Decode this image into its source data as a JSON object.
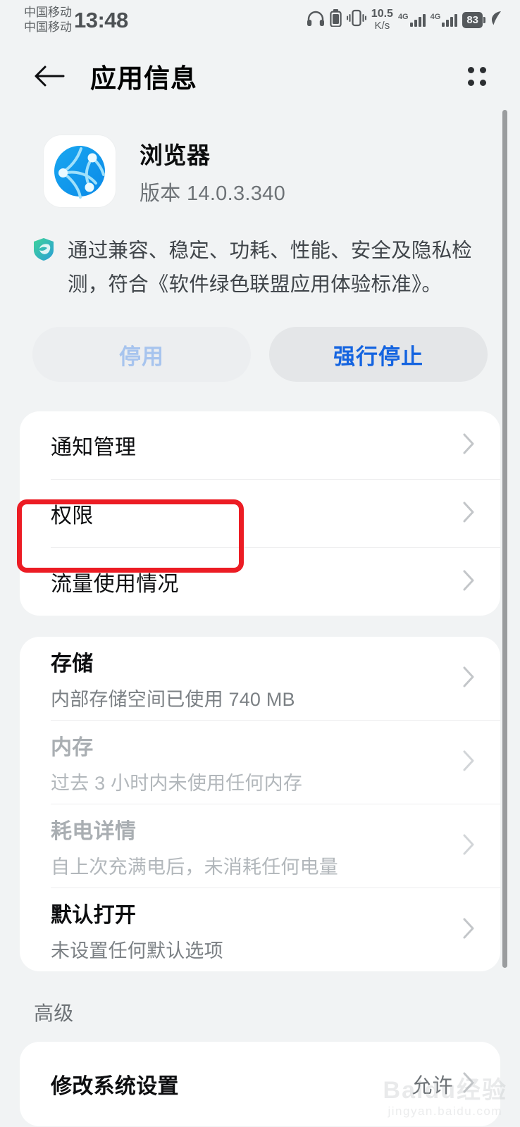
{
  "status_bar": {
    "carrier_line1": "中国移动",
    "carrier_line2": "中国移动",
    "time": "13:48",
    "net_speed_value": "10.5",
    "net_speed_unit": "K/s",
    "signal1_label": "4G",
    "signal2_label": "4G",
    "battery_percent": "83",
    "icons": [
      "headphones-icon",
      "headset-battery-icon",
      "vibrate-icon",
      "signal-icon",
      "battery-icon",
      "power-saving-leaf-icon"
    ]
  },
  "app_bar": {
    "back_icon": "arrow-left-icon",
    "title": "应用信息",
    "menu_icon": "grid-dots-menu-icon"
  },
  "app_header": {
    "icon_name": "browser-globe-icon",
    "name": "浏览器",
    "version": "版本 14.0.3.340"
  },
  "certification": {
    "icon_name": "green-alliance-badge-icon",
    "text": "通过兼容、稳定、功耗、性能、安全及隐私检测，符合《软件绿色联盟应用体验标准》。"
  },
  "actions": {
    "disable_label": "停用",
    "force_stop_label": "强行停止"
  },
  "cards": {
    "basic": [
      {
        "title": "通知管理",
        "sub": "",
        "value": "",
        "dim": false
      },
      {
        "title": "权限",
        "sub": "",
        "value": "",
        "dim": false
      },
      {
        "title": "流量使用情况",
        "sub": "",
        "value": "",
        "dim": false
      }
    ],
    "usage": [
      {
        "title": "存储",
        "sub": "内部存储空间已使用 740 MB",
        "value": "",
        "dim": false
      },
      {
        "title": "内存",
        "sub": "过去 3 小时内未使用任何内存",
        "value": "",
        "dim": true
      },
      {
        "title": "耗电详情",
        "sub": "自上次充满电后，未消耗任何电量",
        "value": "",
        "dim": true
      },
      {
        "title": "默认打开",
        "sub": "未设置任何默认选项",
        "value": "",
        "dim": false
      }
    ],
    "advanced_label": "高级",
    "advanced": [
      {
        "title": "修改系统设置",
        "sub": "",
        "value": "允许",
        "dim": false
      }
    ]
  },
  "annotation": {
    "highlight_target": "权限",
    "highlight_color": "#ec1c24"
  },
  "watermark": {
    "main": "Baidu经验",
    "sub": "jingyan.baidu.com"
  }
}
